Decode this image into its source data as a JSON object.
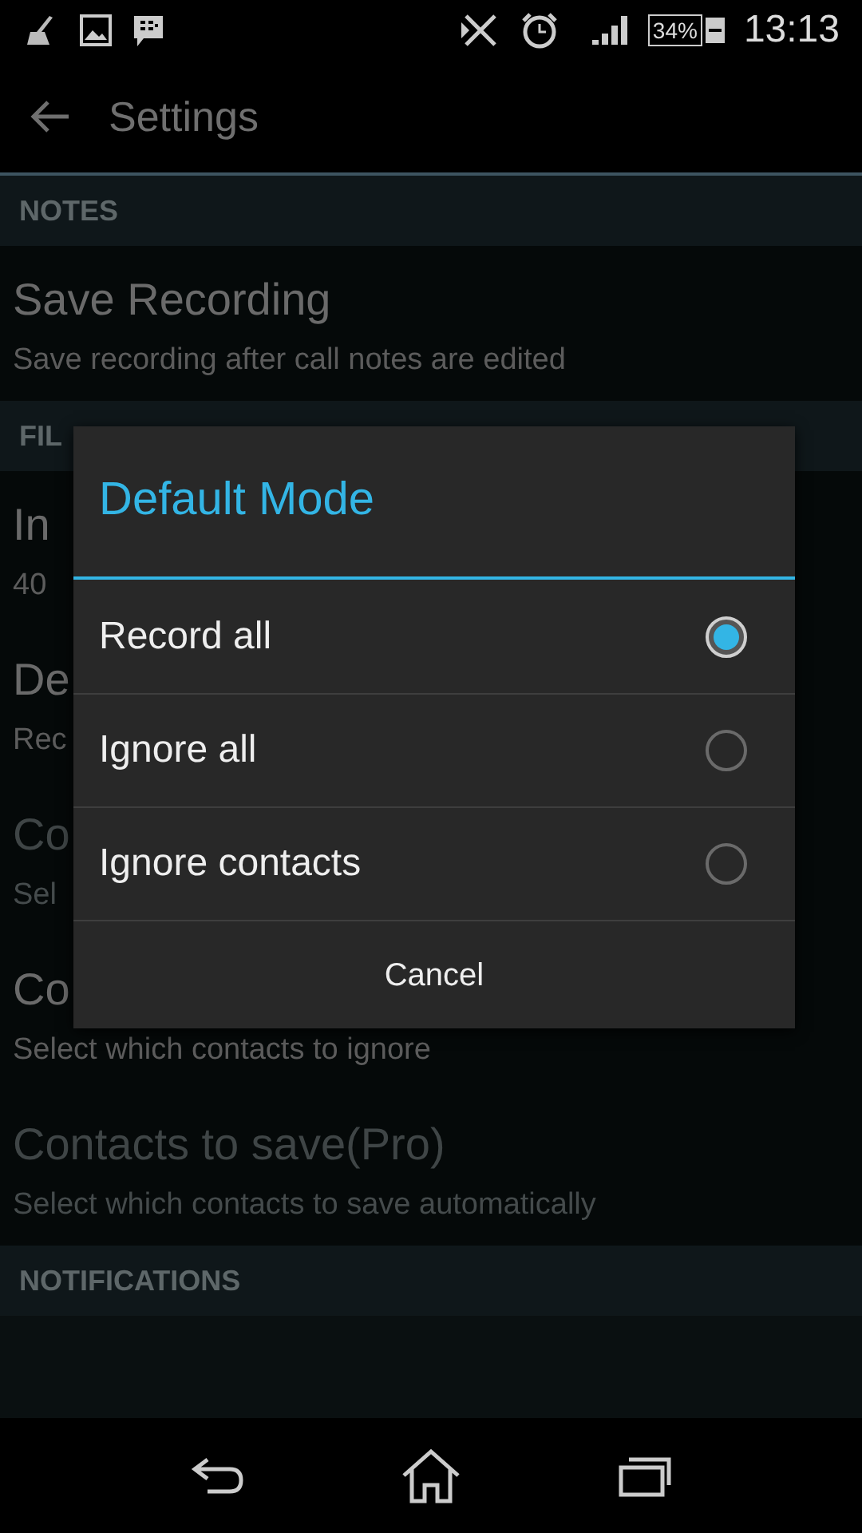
{
  "status_bar": {
    "battery": "34%",
    "time": "13:13"
  },
  "action_bar": {
    "title": "Settings"
  },
  "settings": [
    {
      "kind": "header",
      "title": "NOTES"
    },
    {
      "kind": "pref",
      "title": "Save Recording",
      "summary": "Save recording after call notes are edited",
      "disabled": false
    },
    {
      "kind": "header",
      "title": "FIL"
    },
    {
      "kind": "pref",
      "title": "In",
      "summary": "40",
      "disabled": false
    },
    {
      "kind": "pref",
      "title": "De",
      "summary": "Rec",
      "disabled": false
    },
    {
      "kind": "pref",
      "title": "Co",
      "summary": "Sel",
      "disabled": true
    },
    {
      "kind": "pref",
      "title": "Co",
      "summary": "Select which contacts to ignore",
      "disabled": false
    },
    {
      "kind": "pref",
      "title": "Contacts to save(Pro)",
      "summary": "Select which contacts to save automatically",
      "disabled": true
    },
    {
      "kind": "header",
      "title": "NOTIFICATIONS"
    }
  ],
  "dialog": {
    "title": "Default Mode",
    "options": [
      {
        "label": "Record all",
        "selected": true
      },
      {
        "label": "Ignore all",
        "selected": false
      },
      {
        "label": "Ignore contacts",
        "selected": false
      }
    ],
    "cancel": "Cancel"
  }
}
